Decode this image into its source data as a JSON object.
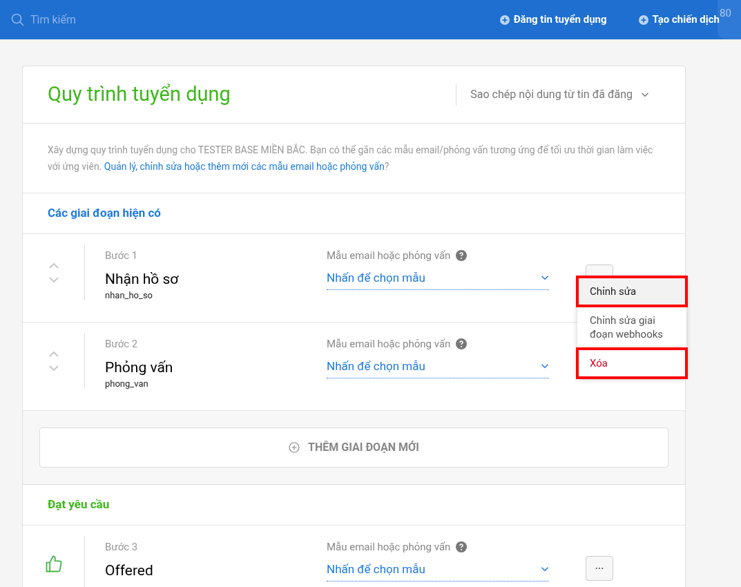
{
  "topbar": {
    "search_placeholder": "Tìm kiếm",
    "actions": [
      "Đăng tin tuyển dụng",
      "Tạo chiến dịch"
    ],
    "zoom_badge": "80"
  },
  "card": {
    "title": "Quy trình tuyển dụng",
    "copy_dropdown": "Sao chép nội dung từ tin đã đăng",
    "description": "Xây dựng quy trình tuyển dụng cho TESTER BASE MIỀN BẮC. Bạn có thể gắn các mẫu email/phỏng vấn tương ứng để tối ưu thời gian làm việc với ứng viên.",
    "description_link": "Quản lý, chỉnh sửa hoặc thêm mới các mẫu email hoặc phỏng vấn",
    "description_end": "?",
    "sections": [
      {
        "title": "Các giai đoạn hiện có",
        "kind": "current",
        "stages": [
          {
            "kind": "movable",
            "step": "Bước 1",
            "name": "Nhận hồ sơ",
            "code": "nhan_ho_so",
            "template_label": "Mẫu email hoặc phỏng vấn",
            "template_value": "Nhấn để chọn mẫu",
            "more_button_visible": true
          },
          {
            "kind": "movable",
            "step": "Bước 2",
            "name": "Phỏng vấn",
            "code": "phong_van",
            "template_label": "Mẫu email hoặc phỏng vấn",
            "template_value": "Nhấn để chọn mẫu",
            "more_button_visible": false
          }
        ],
        "add_button": "THÊM GIAI ĐOẠN MỚI"
      },
      {
        "title": "Đạt yêu cầu",
        "kind": "passed",
        "stages": [
          {
            "kind": "passed",
            "step": "Bước 3",
            "name": "Offered",
            "template_label": "Mẫu email hoặc phỏng vấn",
            "template_value": "Nhấn để chọn mẫu",
            "more_button_visible": true
          }
        ]
      }
    ]
  },
  "context_menu": {
    "items": [
      {
        "label": "Chỉnh sửa",
        "kind": "normal",
        "highlighted": true
      },
      {
        "label": "Chỉnh sửa giai đoạn webhooks",
        "kind": "normal",
        "highlighted": false
      },
      {
        "label": "Xóa",
        "kind": "danger",
        "highlighted": true
      }
    ]
  }
}
